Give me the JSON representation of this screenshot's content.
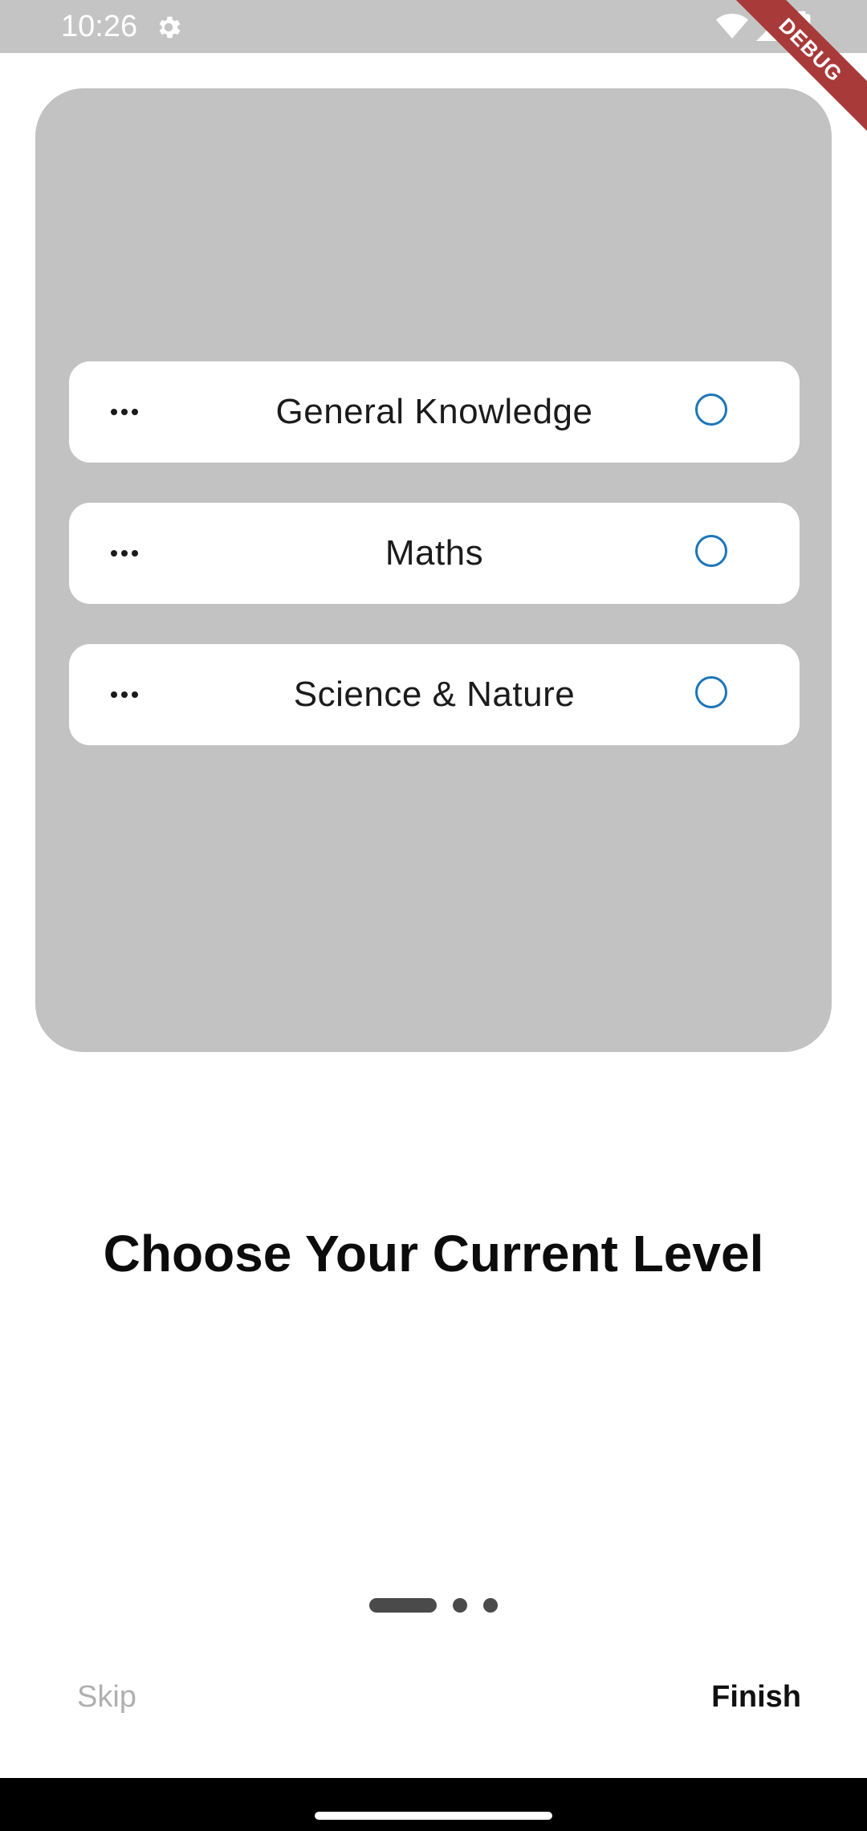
{
  "status_bar": {
    "time": "10:26",
    "icons": [
      "gear-icon",
      "wifi-icon",
      "signal-icon",
      "battery-icon"
    ],
    "debug_label": "DEBUG"
  },
  "options": [
    {
      "label": "General Knowledge",
      "selected": false
    },
    {
      "label": "Maths",
      "selected": false
    },
    {
      "label": "Science & Nature",
      "selected": false
    }
  ],
  "title": "Choose Your Current Level",
  "pager": {
    "current": 1,
    "total": 3
  },
  "buttons": {
    "skip": "Skip",
    "finish": "Finish"
  },
  "colors": {
    "card_bg": "#c2c2c2",
    "radio": "#1c76b8",
    "debug_banner": "#a83a3a"
  }
}
